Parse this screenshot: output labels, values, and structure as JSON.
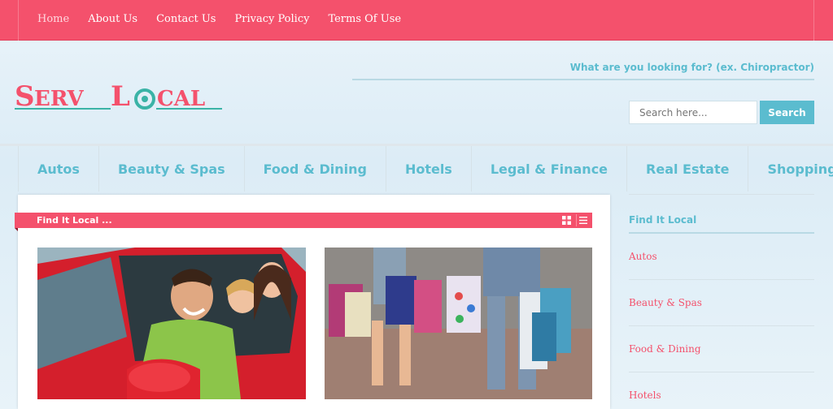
{
  "topnav": {
    "items": [
      "Home",
      "About Us",
      "Contact Us",
      "Privacy Policy",
      "Terms Of Use"
    ],
    "active": "Home"
  },
  "header": {
    "logo_text": "ServLocal",
    "looking_prompt": "What are you looking for? (ex. Chiropractor)",
    "search_placeholder": "Search here...",
    "search_button": "Search"
  },
  "categories": [
    "Autos",
    "Beauty & Spas",
    "Food & Dining",
    "Hotels",
    "Legal & Finance",
    "Real Estate",
    "Shopping"
  ],
  "main": {
    "find_title": "Find It Local ..."
  },
  "sidebar": {
    "title": "Find It Local",
    "items": [
      "Autos",
      "Beauty & Spas",
      "Food & Dining",
      "Hotels"
    ]
  },
  "colors": {
    "brand_pink": "#f4516c",
    "accent_teal": "#5bbccf"
  }
}
